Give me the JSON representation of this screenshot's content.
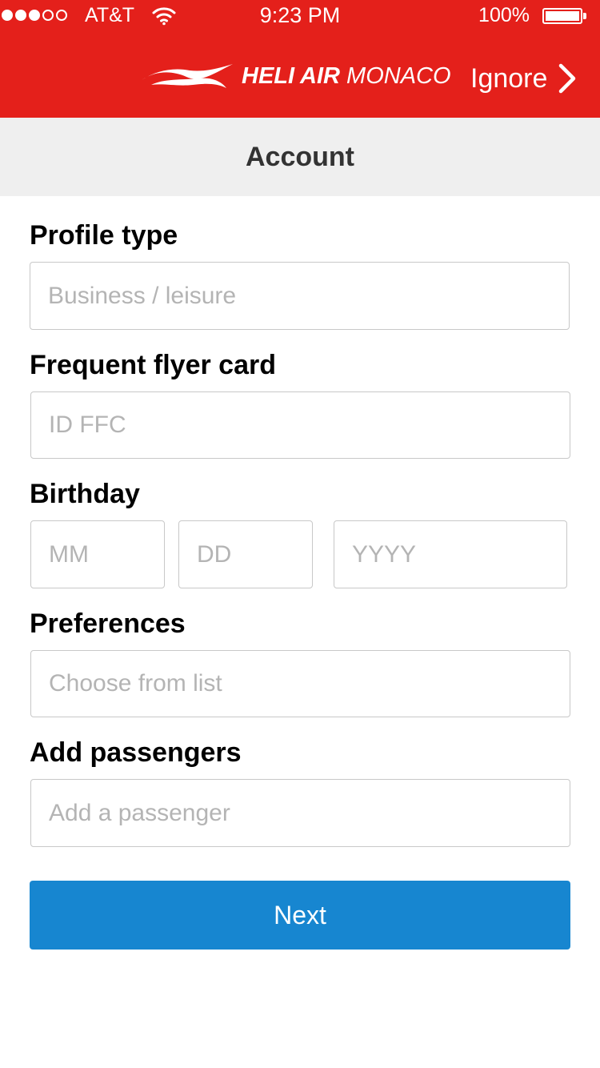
{
  "status_bar": {
    "carrier": "AT&T",
    "time": "9:23 PM",
    "battery_percent": "100%",
    "signal_bars_filled": 3,
    "signal_bars_total": 5
  },
  "header": {
    "brand_strong": "HELI AIR",
    "brand_light": "MONACO",
    "ignore_label": "Ignore",
    "background_color": "#e4201b"
  },
  "page": {
    "title": "Account"
  },
  "form": {
    "profile_type": {
      "label": "Profile type",
      "placeholder": "Business / leisure"
    },
    "frequent_flyer": {
      "label": "Frequent flyer card",
      "placeholder": "ID FFC"
    },
    "birthday": {
      "label": "Birthday",
      "month_placeholder": "MM",
      "day_placeholder": "DD",
      "year_placeholder": "YYYY"
    },
    "preferences": {
      "label": "Preferences",
      "placeholder": "Choose from list"
    },
    "passengers": {
      "label": "Add passengers",
      "placeholder": "Add a passenger"
    }
  },
  "actions": {
    "next_label": "Next",
    "next_color": "#1786d0"
  }
}
